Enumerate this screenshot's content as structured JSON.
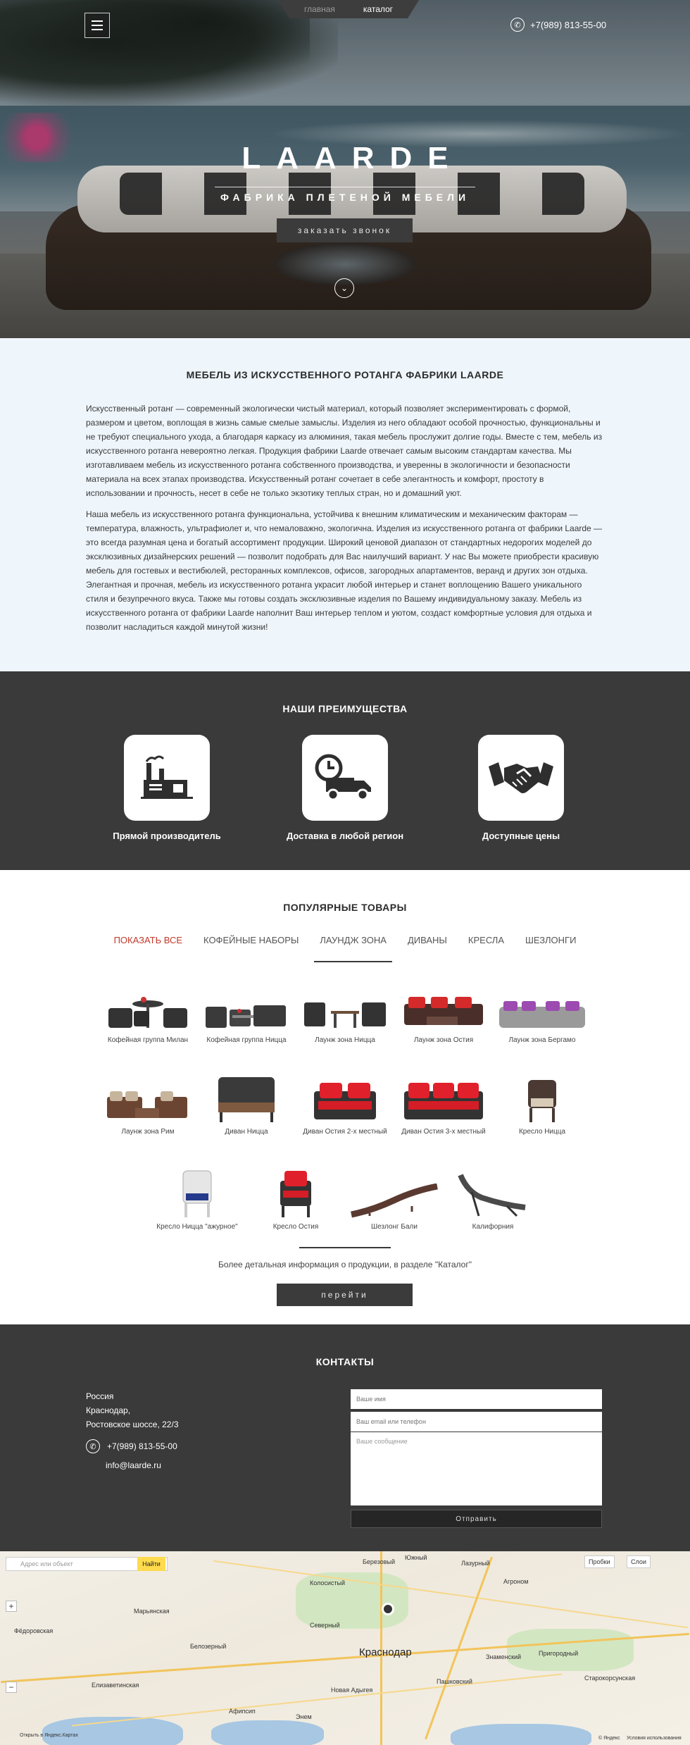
{
  "nav": {
    "home": "главная",
    "catalog": "каталог",
    "phone": "+7(989) 813-55-00"
  },
  "hero": {
    "brand": "LAARDE",
    "tagline": "ФАБРИКА ПЛЕТЕНОЙ МЕБЕЛИ",
    "cta": "заказать звонок"
  },
  "about": {
    "title": "МЕБЕЛЬ ИЗ ИСКУССТВЕННОГО РОТАНГА ФАБРИКИ LAARDE",
    "p1": "Искусственный ротанг — современный экологически чистый материал, который позволяет экспериментировать с формой, размером и цветом, воплощая в жизнь самые смелые замыслы. Изделия из него обладают особой прочностью, функциональны и не требуют специального ухода, а благодаря каркасу из алюминия, такая мебель прослужит долгие годы. Вместе с тем, мебель из искусственного ротанга невероятно легкая. Продукция фабрики Laarde отвечает самым высоким стандартам качества. Мы изготавливаем мебель из искусственного ротанга собственного производства, и уверенны в экологичности и безопасности материала на всех этапах производства. Искусственный ротанг сочетает в себе элегантность и комфорт, простоту в использовании и прочность, несет в себе не только экзотику теплых стран, но и домашний уют.",
    "p2": "Наша мебель из искусственного ротанга функциональна, устойчива к внешним климатическим и механическим факторам — температура, влажность, ультрафиолет и, что немаловажно, экологична. Изделия из искусственного ротанга от фабрики Laarde — это всегда разумная цена и богатый ассортимент продукции. Широкий ценовой диапазон от стандартных недорогих моделей до эксклюзивных дизайнерских решений — позволит подобрать для Вас наилучший вариант. У нас Вы можете приобрести красивую мебель для гостевых и вестибюлей, ресторанных комплексов, офисов, загородных апартаментов, веранд и других зон отдыха. Элегантная и прочная, мебель из искусственного ротанга украсит любой интерьер и станет воплощению Вашего уникального стиля и безупречного вкуса. Также мы готовы создать эксклюзивные изделия по Вашему индивидуальному заказу. Мебель из искусственного ротанга от фабрики Laarde наполнит Ваш интерьер теплом и уютом, создаст комфортные условия для отдыха и позволит насладиться каждой минутой жизни!"
  },
  "advantages": {
    "title": "НАШИ ПРЕИМУЩЕСТВА",
    "items": [
      {
        "label": "Прямой производитель",
        "icon": "factory-icon"
      },
      {
        "label": "Доставка в любой регион",
        "icon": "delivery-truck-icon"
      },
      {
        "label": "Доступные цены",
        "icon": "handshake-icon"
      }
    ]
  },
  "products": {
    "title": "ПОПУЛЯРНЫЕ ТОВАРЫ",
    "tabs": [
      "ПОКАЗАТЬ ВСЕ",
      "КОФЕЙНЫЕ НАБОРЫ",
      "ЛАУНДЖ ЗОНА",
      "ДИВАНЫ",
      "КРЕСЛА",
      "ШЕЗЛОНГИ"
    ],
    "items": [
      "Кофейная группа Милан",
      "Кофейная группа Ницца",
      "Лаунж зона Ницца",
      "Лаунж зона Остия",
      "Лаунж зона Бергамо",
      "Лаунж зона Рим",
      "Диван Ницца",
      "Диван Остия 2-х местный",
      "Диван Остия 3-х местный",
      "Кресло Ницца",
      "Кресло Ницца \"ажурное\"",
      "Кресло Остия",
      "Шезлонг Бали",
      "Калифорния"
    ],
    "more_text": "Более детальная информация о продукции, в разделе \"Каталог\"",
    "more_btn": "перейти"
  },
  "contacts": {
    "title": "КОНТАКТЫ",
    "country": "Россия",
    "city": "Краснодар,",
    "street": "Ростовское шоссе, 22/3",
    "phone": "+7(989) 813-55-00",
    "email": "info@laarde.ru",
    "name_ph": "Ваше имя",
    "contact_ph": "Ваш email или телефон",
    "message_ph": "Ваше сообщение",
    "send": "Отправить"
  },
  "map": {
    "search_ph": "Адрес или объект",
    "find": "Найти",
    "traffic": "Пробки",
    "layers": "Слои",
    "city": "Краснодар",
    "open_link": "Открыть в Яндекс.Картах",
    "copyright": "© Яндекс",
    "terms": "Условия использования",
    "places": [
      "Марьянская",
      "Фёдоровская",
      "Елизаветинская",
      "Белозерный",
      "Новая Адыгея",
      "Пригородный",
      "Старокорсунская",
      "Северный",
      "Энем",
      "Афипсип",
      "Пашковский",
      "Южный",
      "Лазурный",
      "Знаменский",
      "Колосистый",
      "Березовый",
      "Агроном"
    ]
  }
}
